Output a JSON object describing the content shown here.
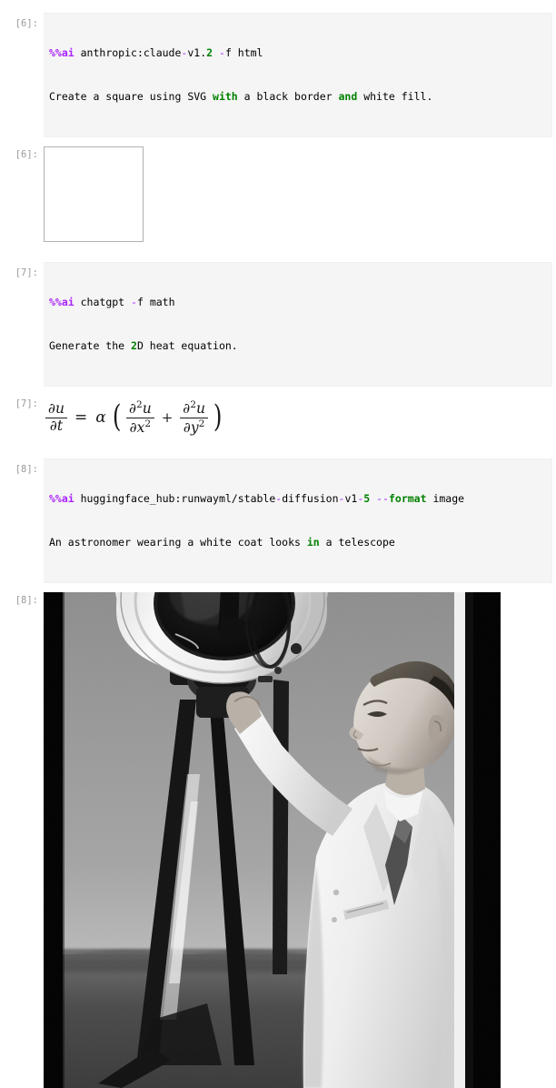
{
  "notebook": {
    "cells": [
      {
        "id": "cell-6",
        "prompt_in": "[6]:",
        "prompt_out": "[6]:",
        "code_line_1": {
          "magic": "%%ai",
          "target": " anthropic:claude",
          "dash1": "-",
          "version_prefix": "v1.",
          "version_num": "2",
          "space": " ",
          "dash2": "-",
          "flag": "f html"
        },
        "code_line_2": {
          "pre": "Create a square using SVG ",
          "kw1": "with",
          "mid": " a black border ",
          "kw2": "and",
          "post": " white fill."
        },
        "output_type": "svg-square",
        "output_label": "white square with black border"
      },
      {
        "id": "cell-7",
        "prompt_in": "[7]:",
        "prompt_out": "[7]:",
        "code_line_1": {
          "magic": "%%ai",
          "target": " chatgpt",
          "space": " ",
          "dash2": "-",
          "flag": "f math"
        },
        "code_line_2": {
          "pre": "Generate the ",
          "num": "2",
          "post": "D heat equation."
        },
        "output_type": "math",
        "math": {
          "lhs_num": "∂u",
          "lhs_den": "∂t",
          "equals": "=",
          "alpha": "α",
          "paren_open": "(",
          "t1_num_base": "∂",
          "t1_num_sup": "2",
          "t1_num_var": "u",
          "t1_den_base": "∂x",
          "t1_den_sup": "2",
          "plus": "+",
          "t2_num_base": "∂",
          "t2_num_sup": "2",
          "t2_num_var": "u",
          "t2_den_base": "∂y",
          "t2_den_sup": "2",
          "paren_close": ")",
          "plain": "∂u/∂t = α (∂²u/∂x² + ∂²u/∂y²)"
        }
      },
      {
        "id": "cell-8",
        "prompt_in": "[8]:",
        "prompt_out": "[8]:",
        "code_line_1": {
          "magic": "%%ai",
          "target": " huggingface_hub:runwayml/stable",
          "dash1": "-",
          "mid1": "diffusion",
          "dash2": "-",
          "mid2": "v1",
          "dash3": "-",
          "num": "5",
          "space": " ",
          "dashdash": "--",
          "kw": "format",
          "flag": " image"
        },
        "code_line_2": {
          "pre": "An astronomer wearing a white coat looks ",
          "kw": "in",
          "post": " a telescope"
        },
        "output_type": "image",
        "image_alt": "black and white photo of an astronomer in a white lab coat looking up at a white telescope on a black tripod"
      }
    ]
  },
  "colors": {
    "magic": "#aa22ff",
    "keyword": "#008000",
    "number": "#008000",
    "prompt": "#9a9a9a",
    "input_bg": "#f5f5f5",
    "text": "#000000"
  }
}
